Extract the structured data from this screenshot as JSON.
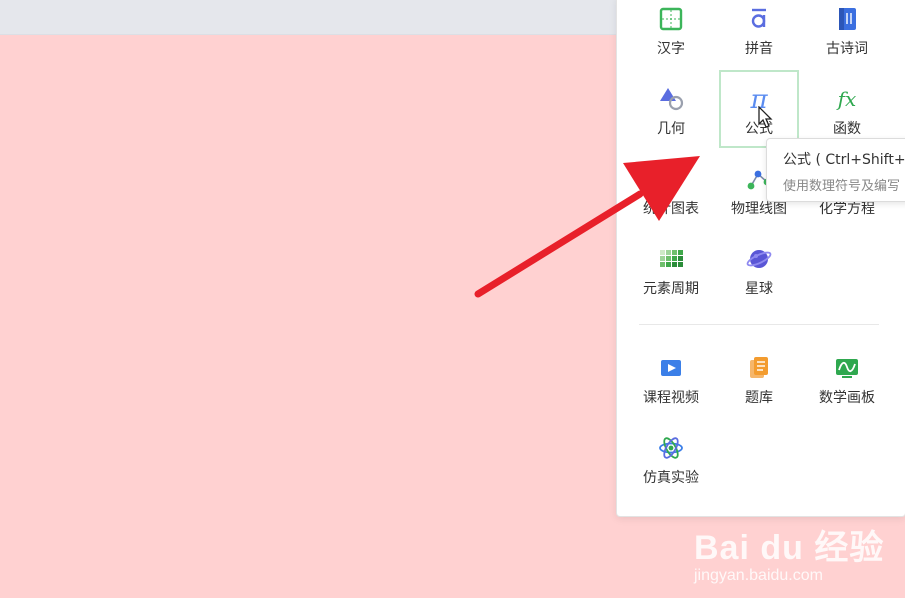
{
  "tools": [
    {
      "id": "hanzi",
      "label": "汉字",
      "icon": "hanzi-grid-icon"
    },
    {
      "id": "pinyin",
      "label": "拼音",
      "icon": "pinyin-a-icon"
    },
    {
      "id": "gushici",
      "label": "古诗词",
      "icon": "book-icon"
    },
    {
      "id": "jihe",
      "label": "几何",
      "icon": "geometry-shapes-icon"
    },
    {
      "id": "gongshi",
      "label": "公式",
      "icon": "pi-icon"
    },
    {
      "id": "hanshu",
      "label": "函数",
      "icon": "fx-icon"
    },
    {
      "id": "tongji",
      "label": "统计图表",
      "icon": "chart-icon"
    },
    {
      "id": "wuli",
      "label": "物理线图",
      "icon": "circuit-icon"
    },
    {
      "id": "huaxue",
      "label": "化学方程",
      "icon": "flask-icon"
    },
    {
      "id": "yuansu",
      "label": "元素周期",
      "icon": "periodic-table-icon"
    },
    {
      "id": "xingqiu",
      "label": "星球",
      "icon": "planet-icon"
    },
    {
      "id": "kecheng",
      "label": "课程视频",
      "icon": "video-icon"
    },
    {
      "id": "tiku",
      "label": "题库",
      "icon": "question-bank-icon"
    },
    {
      "id": "shuxue",
      "label": "数学画板",
      "icon": "math-board-icon"
    },
    {
      "id": "fangzhen",
      "label": "仿真实验",
      "icon": "atom-icon"
    }
  ],
  "tooltip": {
    "title": "公式 ( Ctrl+Shift+",
    "desc": "使用数理符号及编写"
  },
  "watermark": {
    "logo": "Bai du 经验",
    "url": "jingyan.baidu.com"
  },
  "colors": {
    "background": "#ffd1d1",
    "arrow": "#e8202a",
    "selected_border": "#bfe7c9"
  }
}
